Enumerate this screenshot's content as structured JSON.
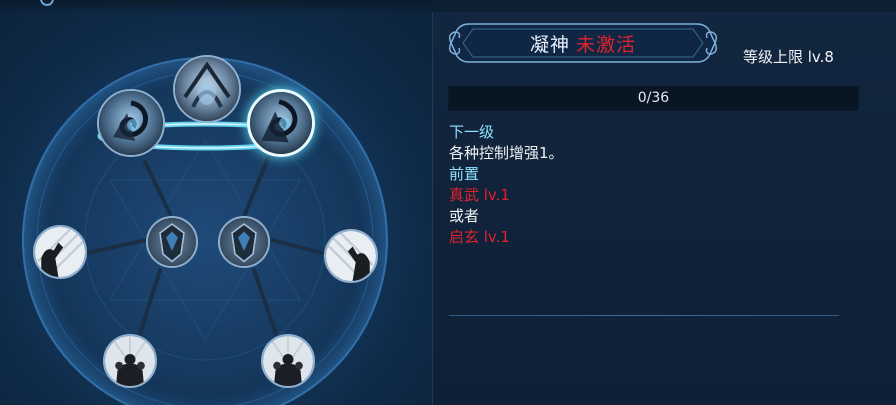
{
  "skill": {
    "name": "凝神",
    "status": "未激活",
    "level_cap": "等级上限 lv.8",
    "progress_text": "0/36",
    "progress_value": 0
  },
  "details": {
    "next_level_label": "下一级",
    "next_level_effect": "各种控制增强1。",
    "prereq_label": "前置",
    "prereq_1": "真武 lv.1",
    "or_label": "或者",
    "prereq_2": "启玄 lv.1"
  },
  "colors": {
    "accent_cyan": "#8fe1ff",
    "status_red": "#e0222c",
    "active_glow": "#5fe0ff"
  },
  "tree": {
    "nodes": [
      {
        "id": "top-left",
        "icon": "dark-spiral-skill-icon",
        "active": false
      },
      {
        "id": "top-center",
        "icon": "swirl-shield-skill-icon",
        "active": false
      },
      {
        "id": "top-right",
        "icon": "dark-spiral-skill-icon",
        "active": true
      },
      {
        "id": "mid-far-left",
        "icon": "silhouette-rays-skill-icon",
        "active": false
      },
      {
        "id": "mid-left",
        "icon": "armor-crest-skill-icon",
        "active": false
      },
      {
        "id": "mid-right",
        "icon": "armor-crest-skill-icon",
        "active": false
      },
      {
        "id": "mid-far-right",
        "icon": "silhouette-rays-skill-icon",
        "active": false
      },
      {
        "id": "bottom-left",
        "icon": "warrior-group-skill-icon",
        "active": false
      },
      {
        "id": "bottom-right",
        "icon": "warrior-group-skill-icon",
        "active": false
      }
    ]
  }
}
